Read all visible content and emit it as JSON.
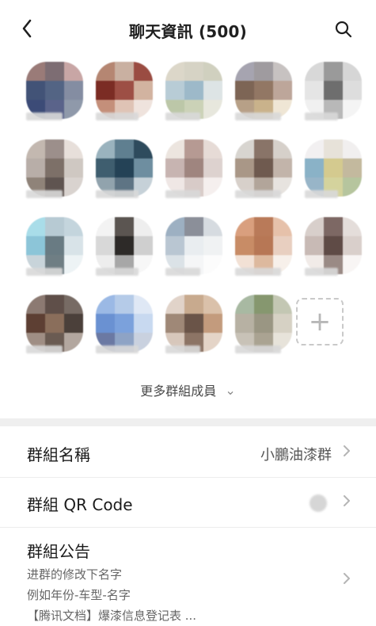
{
  "header": {
    "title": "聊天資訊 (500)",
    "back_icon": "chevron-left-icon",
    "search_icon": "search-icon"
  },
  "members": [
    {
      "name": "",
      "colors": [
        "#9a7b78",
        "#7d6d73",
        "#c8a6a5",
        "#425377",
        "#536484",
        "#848da2",
        "#3c4b77",
        "#5a638a",
        "#8f99aa"
      ]
    },
    {
      "name": "",
      "colors": [
        "#b58672",
        "#c9b0a1",
        "#9a4c42",
        "#7b2c24",
        "#9d4f45",
        "#d2b3a0",
        "#c48f7a",
        "#dfc3b5",
        "#efe3dd"
      ]
    },
    {
      "name": "",
      "colors": [
        "#dcd7c9",
        "#d6d3c5",
        "#d0d0bf",
        "#b8ccd6",
        "#9db9c9",
        "#dde4e5",
        "#bcc7a8",
        "#cbd2b7",
        "#e7e7dd"
      ]
    },
    {
      "name": "",
      "colors": [
        "#a6a4b0",
        "#9f9b9f",
        "#c7c2c1",
        "#7d6555",
        "#927764",
        "#bda69a",
        "#b7a087",
        "#c9b28b",
        "#efe6d5"
      ]
    },
    {
      "name": "",
      "colors": [
        "#d8d8d8",
        "#9a9a9a",
        "#d6d6d6",
        "#e5e5e5",
        "#6e6e6e",
        "#dddddd",
        "#f0f0f0",
        "#b8b8b8",
        "#f4f4f4"
      ]
    },
    {
      "name": "",
      "colors": [
        "#c3b8b0",
        "#9c8f8b",
        "#e7dfda",
        "#b8aea8",
        "#7d7068",
        "#cfc8c2",
        "#8f8379",
        "#5f5450",
        "#d9d3cf"
      ]
    },
    {
      "name": "",
      "colors": [
        "#9ab3be",
        "#5f7f90",
        "#2e4b5d",
        "#3f5e6f",
        "#244256",
        "#6e8ea0",
        "#91a3ad",
        "#5e7484",
        "#c6d1d8"
      ]
    },
    {
      "name": "",
      "colors": [
        "#ece5df",
        "#b69a93",
        "#e6dbd6",
        "#c7b4b1",
        "#9f857f",
        "#ddd2cf",
        "#efe7e5",
        "#d8cbc8",
        "#f5efee"
      ]
    },
    {
      "name": "",
      "colors": [
        "#d8d5d0",
        "#897468",
        "#d6d0ca",
        "#a99787",
        "#6f5a4f",
        "#c2b4aa",
        "#d7d0ca",
        "#b2a59a",
        "#e7e3df"
      ]
    },
    {
      "name": "",
      "colors": [
        "#f2f0f1",
        "#e7e2d9",
        "#f1efef",
        "#8ab2c7",
        "#d4ca8f",
        "#c3b99e",
        "#98b5c8",
        "#d4d39d",
        "#b6c59e"
      ]
    },
    {
      "name": "",
      "colors": [
        "#a9dde9",
        "#b7cad3",
        "#c4d5dd",
        "#8cc5d8",
        "#697b83",
        "#d8e3e8",
        "#c8d4da",
        "#6f7e84",
        "#edf3f5"
      ]
    },
    {
      "name": "",
      "colors": [
        "#f3f3f3",
        "#5b5551",
        "#eeeeee",
        "#d8d8d8",
        "#2d2a28",
        "#cfcfcf",
        "#ededed",
        "#a7a7a7",
        "#f7f7f7"
      ]
    },
    {
      "name": "",
      "colors": [
        "#9db0c2",
        "#8b8f99",
        "#d6dbe0",
        "#b9c6d2",
        "#e9edf0",
        "#f0f2f3",
        "#dbe2e7",
        "#f5f6f7",
        "#fcfcfc"
      ]
    },
    {
      "name": "",
      "colors": [
        "#d99f7e",
        "#b97a59",
        "#e6c1aa",
        "#c88c66",
        "#b77755",
        "#e8cfc0",
        "#f2e1d5",
        "#ddb99e",
        "#f7f0ea"
      ]
    },
    {
      "name": "",
      "colors": [
        "#d8cfcb",
        "#7d6864",
        "#e4ddda",
        "#c8bab5",
        "#5f4b46",
        "#d9cfcb",
        "#f1ebe8",
        "#9a8a85",
        "#f8f5f4"
      ]
    },
    {
      "name": "",
      "colors": [
        "#8c7a72",
        "#5f4f49",
        "#776b64",
        "#5d3f33",
        "#8a6e5b",
        "#4b403a",
        "#9f8e84",
        "#6a5b52",
        "#b3a79f"
      ]
    },
    {
      "name": "",
      "colors": [
        "#9bb9e5",
        "#b5cbe8",
        "#dfe8f5",
        "#6a91d2",
        "#7ba1dc",
        "#c8d9f0",
        "#6b79a3",
        "#8ea3c5",
        "#c9d1df"
      ]
    },
    {
      "name": "",
      "colors": [
        "#e1d3c9",
        "#c8aa8e",
        "#dac1aa",
        "#9f8877",
        "#6a5448",
        "#c39b7d",
        "#d7c7bb",
        "#8c7465",
        "#e4d4c7"
      ]
    },
    {
      "name": "",
      "colors": [
        "#a8b9a2",
        "#86976f",
        "#c3c7b3",
        "#b7b1a3",
        "#9a9683",
        "#d6d1c4",
        "#c8c2b7",
        "#aaa392",
        "#e7e3da"
      ]
    }
  ],
  "add_member_icon": "plus-icon",
  "more_members": {
    "label": "更多群組成員",
    "chevron_icon": "chevron-down-icon"
  },
  "settings": {
    "group_name": {
      "label": "群組名稱",
      "value": "小鵬油漆群"
    },
    "group_qr": {
      "label": "群組 QR Code",
      "value": ""
    },
    "group_notice": {
      "label": "群組公告",
      "line1": "进群的修改下名字",
      "line2": "例如年份-车型-名字",
      "line3": "【腾讯文档】爆漆信息登记表 ..."
    }
  }
}
